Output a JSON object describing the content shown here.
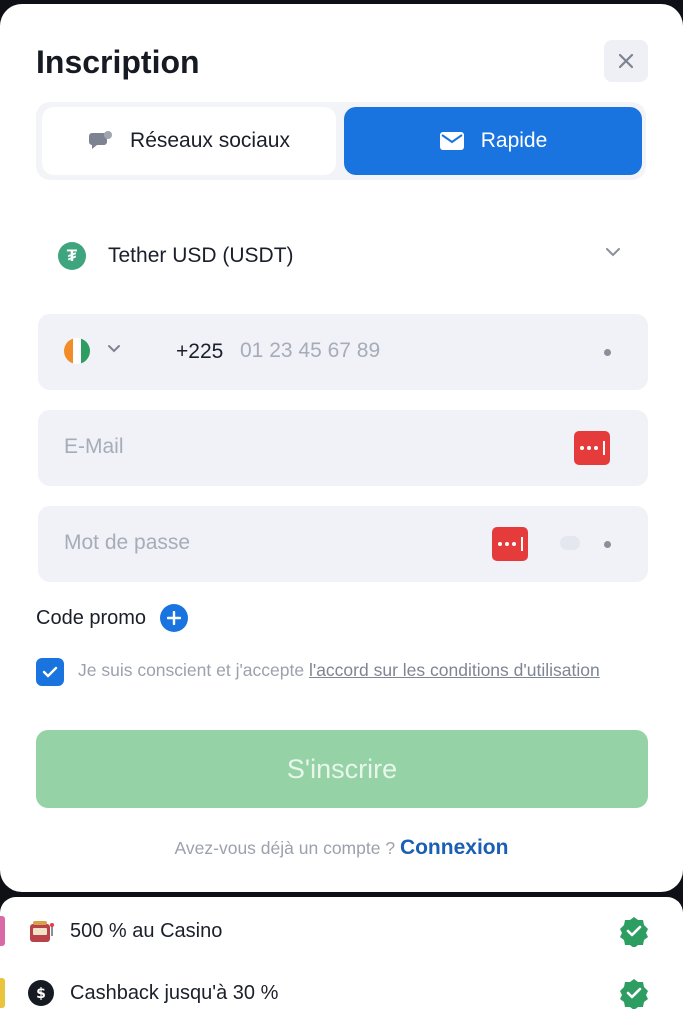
{
  "title": "Inscription",
  "tabs": {
    "social_label": "Réseaux sociaux",
    "fast_label": "Rapide"
  },
  "currency": {
    "label": "Tether USD (USDT)",
    "icon": "tether-icon"
  },
  "phone": {
    "country_code": "+225",
    "placeholder": "01 23 45 67 89",
    "flag": "cote-divoire-flag"
  },
  "email": {
    "placeholder": "E-Mail"
  },
  "password": {
    "placeholder": "Mot de passe"
  },
  "promo": {
    "label": "Code promo"
  },
  "terms": {
    "text": "Je suis conscient et j'accepte ",
    "link": "l'accord sur les conditions d'utilisation",
    "checked": true
  },
  "submit_label": "S'inscrire",
  "login": {
    "question": "Avez-vous déjà un compte ?",
    "link": "Connexion"
  },
  "bonuses": [
    {
      "label": "500 % au Casino",
      "icon": "slot-machine-icon"
    },
    {
      "label": "Cashback jusqu'à 30 %",
      "icon": "cashback-icon"
    }
  ],
  "colors": {
    "accent": "#1a74e0",
    "submit_disabled": "#95d3a6",
    "badge_red": "#e63b3b",
    "check_green": "#2e9d62"
  }
}
